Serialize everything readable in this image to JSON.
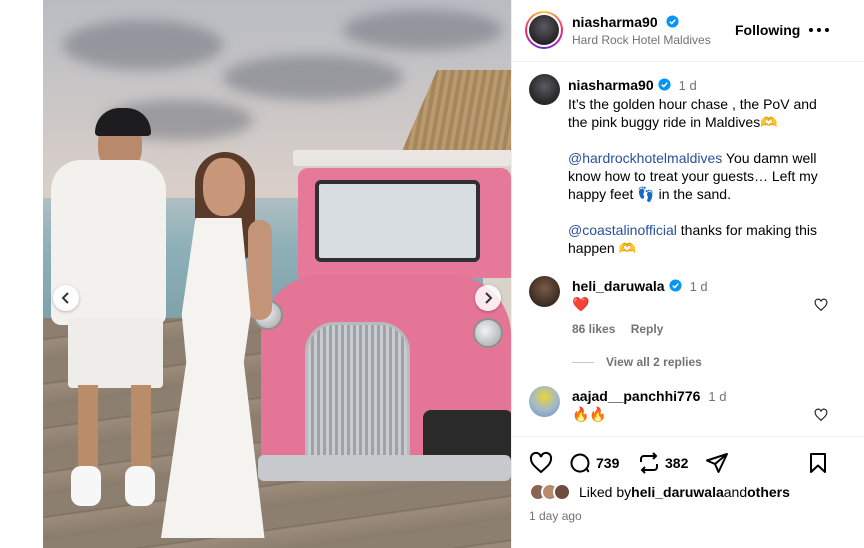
{
  "post": {
    "username": "niasharma90",
    "location": "Hard Rock Hotel Maldives",
    "follow_label": "Following",
    "caption": {
      "username": "niasharma90",
      "time": "1 d",
      "line1": "It’s the golden hour chase , the PoV and the pink buggy ride in Maldives🫶",
      "mention1": "@hardrockhotelmaldives",
      "line2": " You damn well know how to treat your guests… Left my happy feet 👣 in the sand.",
      "mention2": "@coastalinofficial",
      "line3": " thanks for making this happen 🫶"
    },
    "comments": [
      {
        "username": "heli_daruwala",
        "time": "1 d",
        "text": "❤️",
        "likes": "86 likes",
        "reply_label": "Reply",
        "view_replies": "View all 2 replies"
      },
      {
        "username": "aajad__panchhi776",
        "time": "1 d",
        "text": "🔥🔥"
      }
    ],
    "actions": {
      "comment_count": "739",
      "repost_count": "382"
    },
    "liked_by": {
      "prefix": "Liked by ",
      "user": "heli_daruwala",
      "middle": " and ",
      "others": "others"
    },
    "date": "1 day ago"
  },
  "colors": {
    "verified": "#0095f6",
    "mention": "#2a4fa0",
    "secondary_text": "#737373"
  }
}
